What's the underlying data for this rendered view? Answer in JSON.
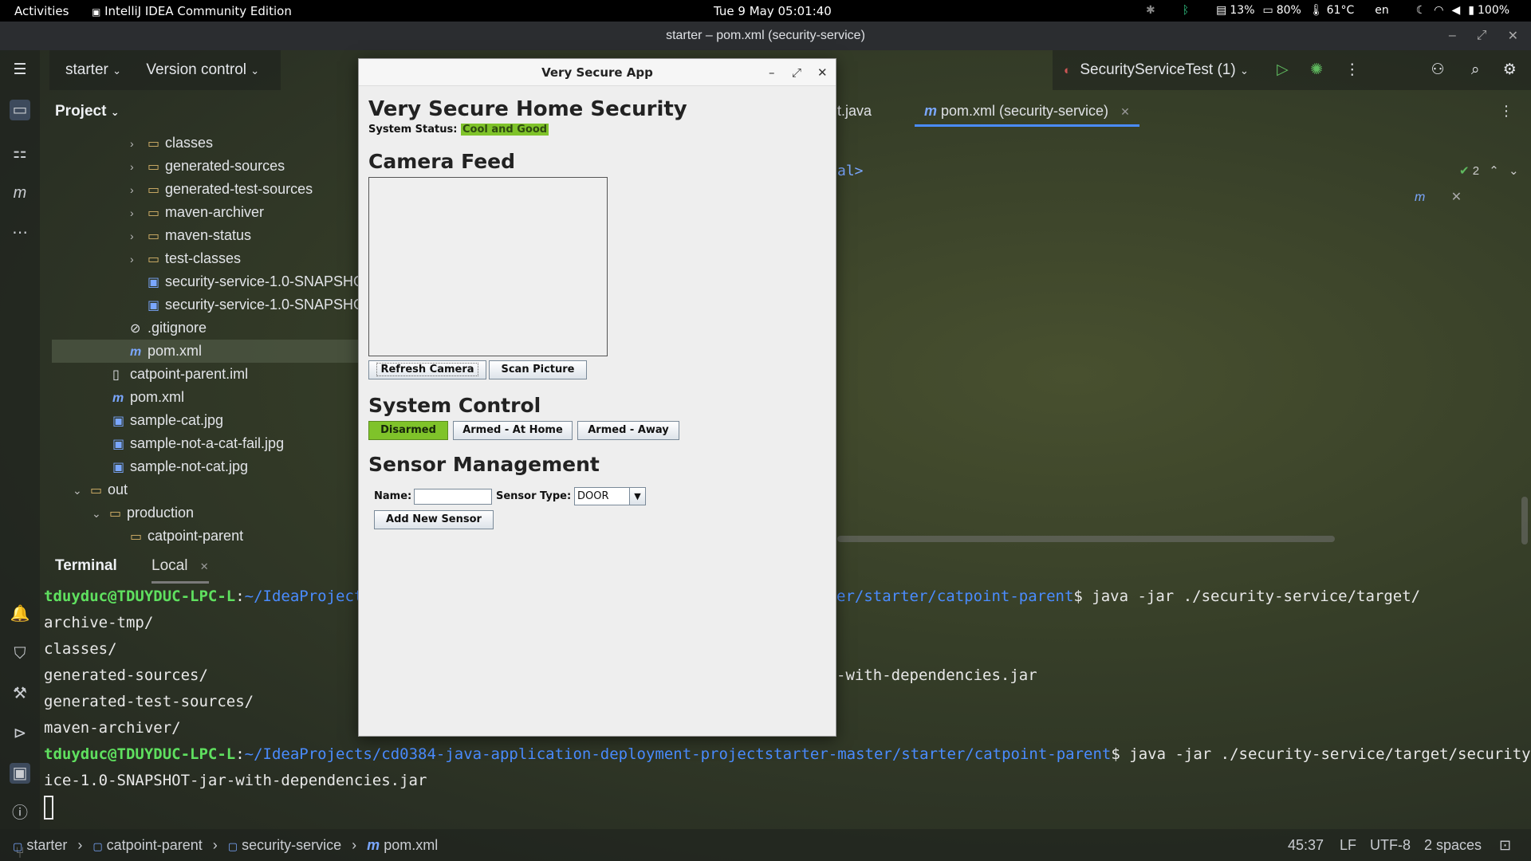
{
  "topbar": {
    "activities": "Activities",
    "app_name": "IntelliJ IDEA Community Edition",
    "datetime": "Tue 9 May  05:01:40",
    "disk": "13%",
    "battery_alt": "80%",
    "temp": "61°C",
    "lang": "en",
    "battery": "100%"
  },
  "window": {
    "title": "starter – pom.xml (security-service)"
  },
  "toolbar": {
    "project_name": "starter",
    "vcs": "Version control",
    "run_config": "SecurityServiceTest (1)"
  },
  "project_panel": {
    "header": "Project",
    "items": [
      {
        "label": "classes",
        "kind": "folder"
      },
      {
        "label": "generated-sources",
        "kind": "folder"
      },
      {
        "label": "generated-test-sources",
        "kind": "folder"
      },
      {
        "label": "maven-archiver",
        "kind": "folder"
      },
      {
        "label": "maven-status",
        "kind": "folder"
      },
      {
        "label": "test-classes",
        "kind": "folder"
      },
      {
        "label": "security-service-1.0-SNAPSHO",
        "kind": "jar"
      },
      {
        "label": "security-service-1.0-SNAPSHO",
        "kind": "jar"
      },
      {
        "label": ".gitignore",
        "kind": "ignore"
      },
      {
        "label": "pom.xml",
        "kind": "maven"
      },
      {
        "label": "catpoint-parent.iml",
        "kind": "file"
      },
      {
        "label": "pom.xml",
        "kind": "maven"
      },
      {
        "label": "sample-cat.jpg",
        "kind": "image"
      },
      {
        "label": "sample-not-a-cat-fail.jpg",
        "kind": "image"
      },
      {
        "label": "sample-not-cat.jpg",
        "kind": "image"
      },
      {
        "label": "out",
        "kind": "folder"
      },
      {
        "label": "production",
        "kind": "folder"
      },
      {
        "label": "catpoint-parent",
        "kind": "folder"
      }
    ]
  },
  "editor": {
    "tab_partial": "t.java",
    "tab_active": "pom.xml (security-service)",
    "code_fragment": "al>",
    "problems_count": "2"
  },
  "terminal": {
    "tab_terminal": "Terminal",
    "tab_local": "Local",
    "user": "tduyduc@TDUYDUC-LPC-L",
    "path_partial": "~/IdeaProjects",
    "path_tail": "er/starter/catpoint-parent",
    "cmd1": "$ java -jar ./security-service/target/",
    "listing": [
      "archive-tmp/",
      "classes/",
      "generated-sources/",
      "generated-test-sources/",
      "maven-archiver/"
    ],
    "listing_jar_tail": "-with-dependencies.jar",
    "path_full": "~/IdeaProjects/cd0384-java-application-deployment-projectstarter-master/starter/catpoint-parent",
    "cmd2": "$ java -jar ./security-service/target/security-serv",
    "cmd2_cont": "ice-1.0-SNAPSHOT-jar-with-dependencies.jar"
  },
  "statusbar": {
    "crumbs": [
      "starter",
      "catpoint-parent",
      "security-service",
      "pom.xml"
    ],
    "position": "45:37",
    "line_ending": "LF",
    "encoding": "UTF-8",
    "indent": "2 spaces"
  },
  "app": {
    "window_title": "Very Secure App",
    "heading": "Very Secure Home Security",
    "status_label": "System Status:",
    "status_value": "Cool and Good",
    "camera_heading": "Camera Feed",
    "refresh_camera": "Refresh Camera",
    "scan_picture": "Scan Picture",
    "control_heading": "System Control",
    "disarmed": "Disarmed",
    "armed_home": "Armed - At Home",
    "armed_away": "Armed - Away",
    "sensor_heading": "Sensor Management",
    "name_label": "Name:",
    "name_value": "",
    "sensor_type_label": "Sensor Type:",
    "sensor_type_value": "DOOR",
    "add_sensor": "Add New Sensor",
    "colors": {
      "status_green": "#7fc32a"
    }
  }
}
